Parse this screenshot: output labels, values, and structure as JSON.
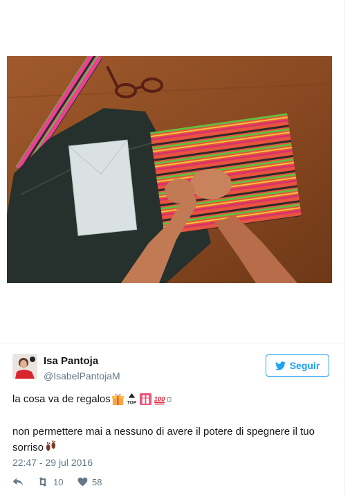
{
  "tweet": {
    "author_name": "Isa Pantoja",
    "author_handle": "@IsabelPantojaM",
    "follow_label": "Seguir",
    "text_line1": "la cosa va de regalos",
    "text_line2": "non permettere mai a nessuno di avere il potere di spegnere il tuo sorriso",
    "timestamp": "22:47 - 29 jul 2016",
    "retweet_count": "10",
    "like_count": "58"
  },
  "icons": {
    "follow": "bird-icon",
    "reply": "reply-icon",
    "retweet": "retweet-icon",
    "like": "heart-icon",
    "emojis": [
      "gift-emoji",
      "top-emoji",
      "dancer-emoji",
      "hundred-emoji",
      "missing-glyph-box",
      "footprints-emoji"
    ]
  },
  "colors": {
    "accent": "#1da1f2",
    "text": "#14171a",
    "muted": "#657786",
    "border": "#e6ecf0"
  }
}
